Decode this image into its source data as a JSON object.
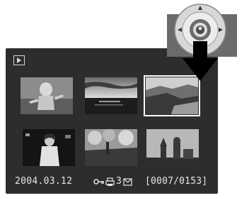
{
  "screen": {
    "mode": "playback",
    "mode_icon": "play-icon",
    "selected_index": 2,
    "thumbnails": [
      {
        "subject": "child-running",
        "tones": [
          "#7d7d7d",
          "#cfcfcf",
          "#3a3a3a"
        ]
      },
      {
        "subject": "sunset-sea",
        "tones": [
          "#b9b9b9",
          "#2a2a2a",
          "#6a6a6a"
        ]
      },
      {
        "subject": "coastal-cliffs",
        "tones": [
          "#d6d6d6",
          "#5a5a5a",
          "#1f1f1f"
        ]
      },
      {
        "subject": "woman-night",
        "tones": [
          "#151515",
          "#d0d0d0",
          "#5a5a5a"
        ]
      },
      {
        "subject": "tree-flowers",
        "tones": [
          "#8a8a8a",
          "#3d3d3d",
          "#bdbdbd"
        ]
      },
      {
        "subject": "church-towers",
        "tones": [
          "#bfbfbf",
          "#2b2b2b",
          "#6e6e6e"
        ]
      }
    ],
    "date": "2004.03.12",
    "print_count": "3",
    "status_icons": [
      "lock-icon",
      "print-icon",
      "email-icon"
    ],
    "frame_counter": "[0007/0153]"
  },
  "controller": {
    "icon": "four-way-controller-icon",
    "arrow": "down-arrow-icon",
    "colors": {
      "body": "#6b6b6b",
      "ring": "#d8d8d8",
      "arrow": "#000000"
    }
  }
}
